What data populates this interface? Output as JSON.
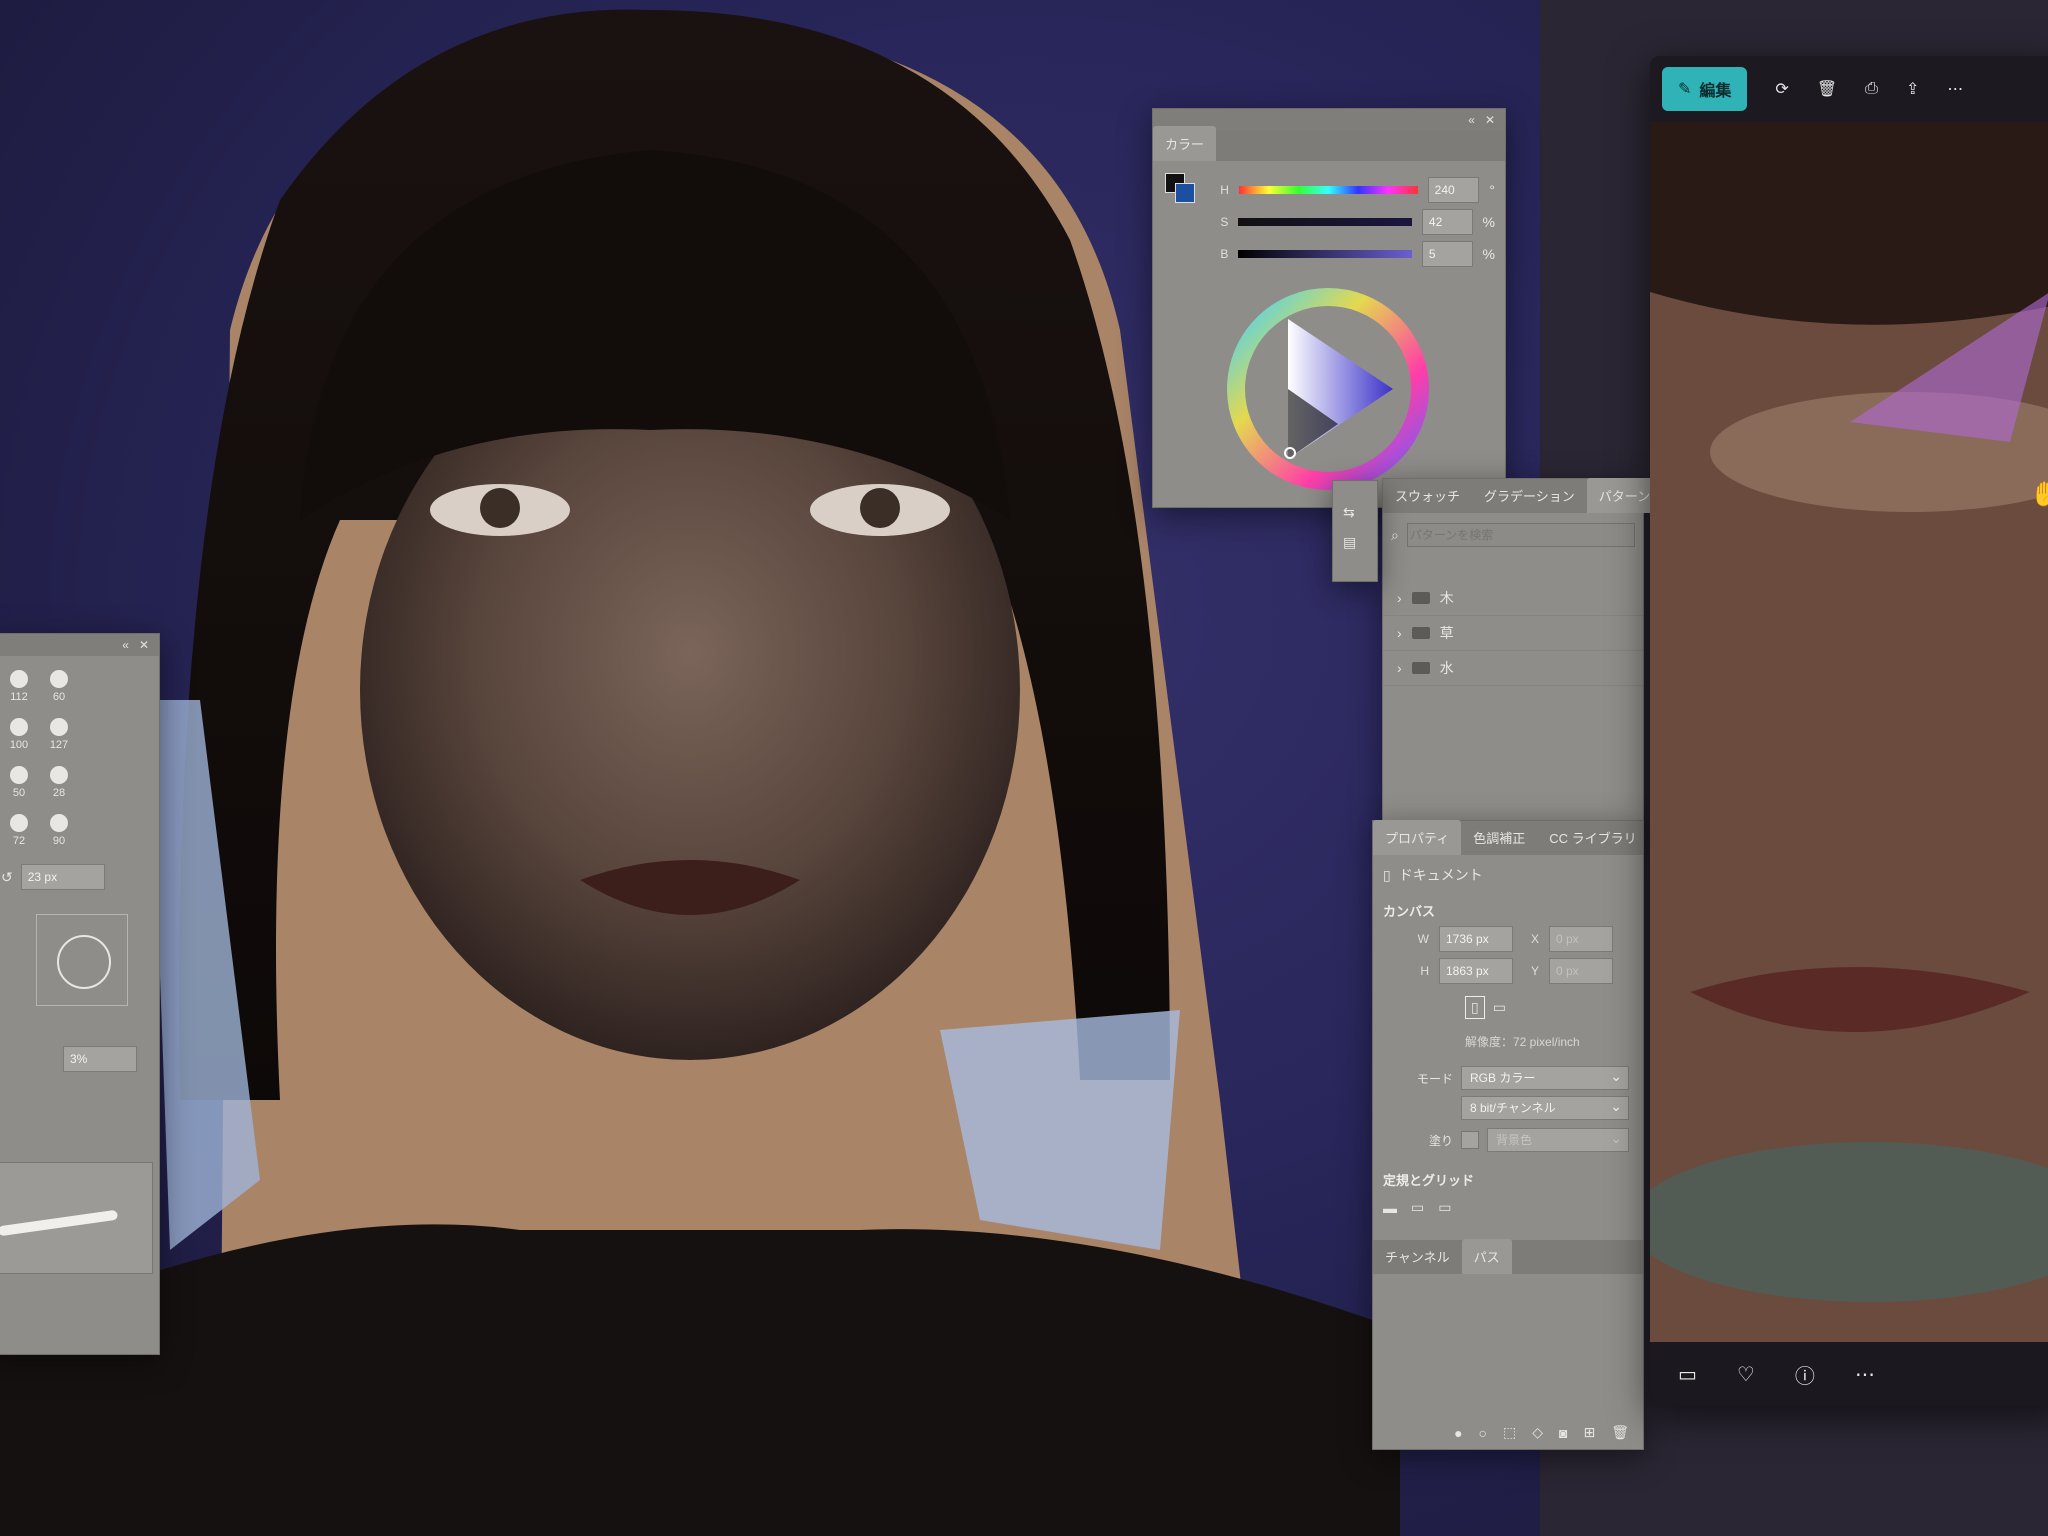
{
  "color_panel": {
    "title": "カラー",
    "hsb": [
      {
        "label": "H",
        "value": "240",
        "unit": "°"
      },
      {
        "label": "S",
        "value": "42",
        "unit": "%"
      },
      {
        "label": "B",
        "value": "5",
        "unit": "%"
      }
    ]
  },
  "library_panel": {
    "tabs": [
      "スウォッチ",
      "グラデーション",
      "パターン"
    ],
    "active_tab": "パターン",
    "search_placeholder": "パターンを検索",
    "folders": [
      "木",
      "草",
      "水"
    ]
  },
  "properties_panel": {
    "tabs": [
      "プロパティ",
      "色調補正",
      "CC ライブラリ"
    ],
    "document_label": "ドキュメント",
    "canvas_section": "カンバス",
    "width_label": "W",
    "width_value": "1736 px",
    "height_label": "H",
    "height_value": "1863 px",
    "x_label": "X",
    "x_value": "0 px",
    "y_label": "Y",
    "y_value": "0 px",
    "resolution": "解像度：72 pixel/inch",
    "mode_label": "モード",
    "mode_value": "RGB カラー",
    "bit_depth": "8 bit/チャンネル",
    "fill_label": "塗り",
    "fill_value": "背景色",
    "rulers_section": "定規とグリッド",
    "bottom_tabs": [
      "チャンネル",
      "パス"
    ]
  },
  "brush_panel": {
    "sizes": [
      "112",
      "60",
      "100",
      "127",
      "50",
      "28",
      "72",
      "90"
    ],
    "size_value": "23 px",
    "percent_value": "3%"
  },
  "photo_viewer": {
    "edit_label": "編集"
  },
  "colors": {
    "accent": "#2fb3b7",
    "panel_gray": "#8e8d89",
    "background_navy": "#28265a"
  }
}
